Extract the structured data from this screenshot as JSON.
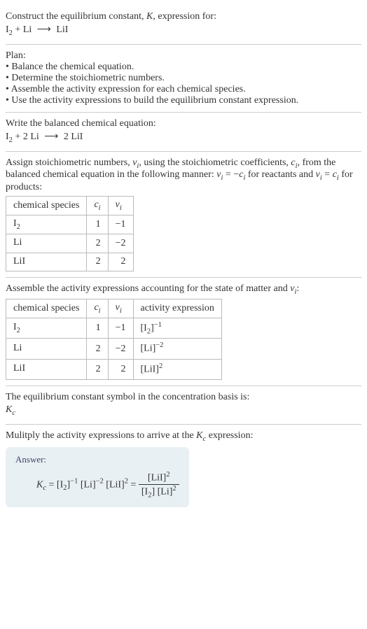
{
  "intro": {
    "line1": "Construct the equilibrium constant, ",
    "K": "K",
    "line1b": ", expression for:",
    "eq_lhs": "I",
    "eq_sub1": "2",
    "eq_plus": " + Li ",
    "eq_arrow": "⟶",
    "eq_rhs": " LiI"
  },
  "plan": {
    "header": "Plan:",
    "b1": "• Balance the chemical equation.",
    "b2": "• Determine the stoichiometric numbers.",
    "b3": "• Assemble the activity expression for each chemical species.",
    "b4": "• Use the activity expressions to build the equilibrium constant expression."
  },
  "balanced": {
    "header": "Write the balanced chemical equation:",
    "lhs1": "I",
    "sub1": "2",
    "plus": " + 2 Li ",
    "arrow": "⟶",
    "rhs": " 2 LiI"
  },
  "stoich": {
    "text1": "Assign stoichiometric numbers, ",
    "nu": "ν",
    "i": "i",
    "text2": ", using the stoichiometric coefficients, ",
    "c": "c",
    "text3": ", from the balanced chemical equation in the following manner: ",
    "eq1a": "ν",
    "eq1b": " = −",
    "eq1c": "c",
    "text4": " for reactants and ",
    "eq2a": "ν",
    "eq2b": " = ",
    "eq2c": "c",
    "text5": " for products:",
    "headers": {
      "h1": "chemical species",
      "h2": "c",
      "h2sub": "i",
      "h3": "ν",
      "h3sub": "i"
    },
    "rows": [
      {
        "sp": "I",
        "spsub": "2",
        "c": "1",
        "nu": "−1"
      },
      {
        "sp": "Li",
        "spsub": "",
        "c": "2",
        "nu": "−2"
      },
      {
        "sp": "LiI",
        "spsub": "",
        "c": "2",
        "nu": "2"
      }
    ]
  },
  "activity": {
    "header1": "Assemble the activity expressions accounting for the state of matter and ",
    "nu": "ν",
    "i": "i",
    "header2": ":",
    "headers": {
      "h1": "chemical species",
      "h2": "c",
      "h2sub": "i",
      "h3": "ν",
      "h3sub": "i",
      "h4": "activity expression"
    },
    "rows": [
      {
        "sp": "I",
        "spsub": "2",
        "c": "1",
        "nu": "−1",
        "act_base": "[I",
        "act_basesub": "2",
        "act_baseend": "]",
        "act_sup": "−1"
      },
      {
        "sp": "Li",
        "spsub": "",
        "c": "2",
        "nu": "−2",
        "act_base": "[Li]",
        "act_basesub": "",
        "act_baseend": "",
        "act_sup": "−2"
      },
      {
        "sp": "LiI",
        "spsub": "",
        "c": "2",
        "nu": "2",
        "act_base": "[LiI]",
        "act_basesub": "",
        "act_baseend": "",
        "act_sup": "2"
      }
    ]
  },
  "symbol": {
    "text": "The equilibrium constant symbol in the concentration basis is:",
    "K": "K",
    "c": "c"
  },
  "multiply": {
    "text1": "Mulitply the activity expressions to arrive at the ",
    "K": "K",
    "c": "c",
    "text2": " expression:"
  },
  "answer": {
    "label": "Answer:",
    "Kc_K": "K",
    "Kc_c": "c",
    "eq": " = ",
    "t1": "[I",
    "t1sub": "2",
    "t1end": "]",
    "t1sup": "−1",
    "sp1": " ",
    "t2": "[Li]",
    "t2sup": "−2",
    "sp2": " ",
    "t3": "[LiI]",
    "t3sup": "2",
    "eq2": " = ",
    "num": "[LiI]",
    "numsup": "2",
    "den1": "[I",
    "den1sub": "2",
    "den1end": "] ",
    "den2": "[Li]",
    "den2sup": "2"
  }
}
